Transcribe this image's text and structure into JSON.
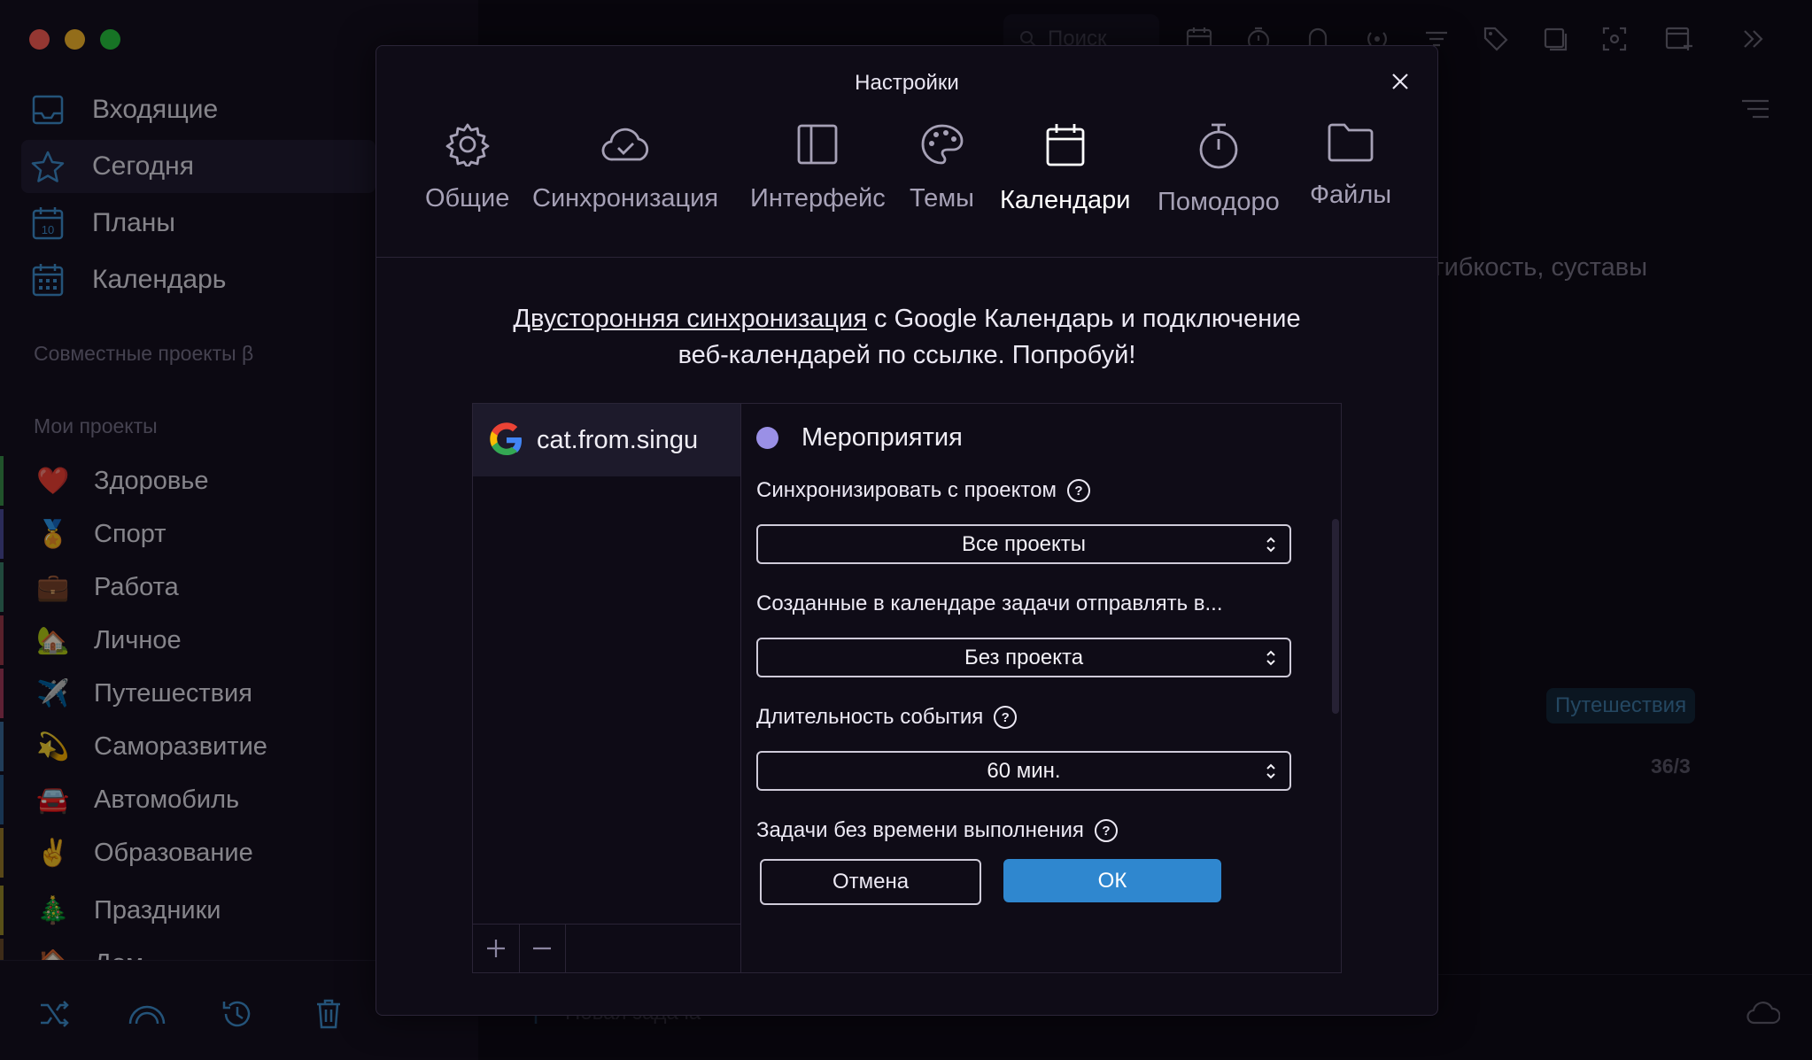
{
  "sidebar": {
    "nav": [
      {
        "label": "Входящие",
        "icon": "inbox-icon"
      },
      {
        "label": "Сегодня",
        "icon": "star-icon"
      },
      {
        "label": "Планы",
        "icon": "calendar-10-icon"
      },
      {
        "label": "Календарь",
        "icon": "calendar-grid-icon"
      }
    ],
    "shared_title": "Совместные проекты β",
    "my_title": "Мои проекты",
    "projects": [
      {
        "label": "Здоровье",
        "emoji": "❤️",
        "color": "#3a8f4a"
      },
      {
        "label": "Спорт",
        "emoji": "🏅",
        "color": "#4a4a9a"
      },
      {
        "label": "Работа",
        "emoji": "💼",
        "color": "#3a7f6a"
      },
      {
        "label": "Личное",
        "emoji": "🏡",
        "color": "#9a3a4a"
      },
      {
        "label": "Путешествия",
        "emoji": "✈️",
        "color": "#a33a5a"
      },
      {
        "label": "Саморазвитие",
        "emoji": "💫",
        "color": "#3a6a9a"
      },
      {
        "label": "Автомобиль",
        "emoji": "🚘",
        "color": "#2a5a8a"
      },
      {
        "label": "Образование",
        "emoji": "✌️",
        "color": "#9a7a2a"
      },
      {
        "label": "Праздники",
        "emoji": "🎄",
        "color": "#9a8a2a"
      },
      {
        "label": "Дом",
        "emoji": "🏠",
        "color": "#6a4a2a"
      }
    ]
  },
  "main": {
    "search_placeholder": "Поиск",
    "bg_task_text": "гибкость, суставы",
    "bg_tag": "Путешествия",
    "bg_count": "36/3",
    "new_task_label": "Новая задача"
  },
  "dialog": {
    "title": "Настройки",
    "tabs": [
      {
        "label": "Общие",
        "icon": "gear-icon"
      },
      {
        "label": "Синхронизация",
        "icon": "cloud-check-icon"
      },
      {
        "label": "Интерфейс",
        "icon": "layout-icon"
      },
      {
        "label": "Темы",
        "icon": "palette-icon"
      },
      {
        "label": "Календари",
        "icon": "calendar-icon"
      },
      {
        "label": "Помодоро",
        "icon": "timer-icon"
      },
      {
        "label": "Файлы",
        "icon": "folder-icon"
      }
    ],
    "active_tab": "Календари",
    "promo_link": "Двусторонняя синхронизация",
    "promo_rest1": " с Google Календарь и подключение",
    "promo_line2": "веб-календарей по ссылке. Попробуй!",
    "account_email": "cat.from.singu",
    "calendar_name": "Мероприятия",
    "calendar_color": "#9a90e6",
    "sync_label": "Синхронизировать с проектом",
    "sync_value": "Все проекты",
    "created_label": "Созданные в календаре задачи отправлять в...",
    "created_value": "Без проекта",
    "duration_label": "Длительность события",
    "duration_value": "60 мин.",
    "notime_label": "Задачи без времени выполнения",
    "cancel_label": "Отмена",
    "ok_label": "ОК",
    "help_glyph": "?"
  }
}
